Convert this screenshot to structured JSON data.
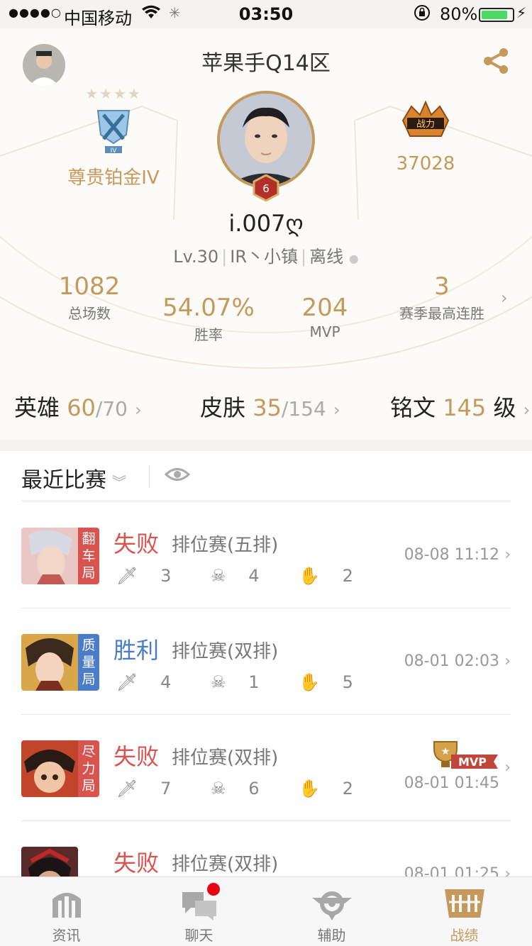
{
  "status": {
    "carrier": "中国移动",
    "time": "03:50",
    "battery": "80%"
  },
  "header": {
    "server": "苹果手Q14区"
  },
  "rank": {
    "label": "尊贵铂金IV"
  },
  "war": {
    "value": "37028"
  },
  "profile": {
    "level_badge": "6",
    "name": "i.007ღ",
    "level": "Lv.30",
    "team": "IR丶小镇",
    "status": "离线"
  },
  "stats": [
    {
      "value": "1082",
      "label": "总场数"
    },
    {
      "value": "54.07%",
      "label": "胜率"
    },
    {
      "value": "204",
      "label": "MVP"
    },
    {
      "value": "3",
      "label": "赛季最高连胜"
    }
  ],
  "collection": {
    "heroes": {
      "label": "英雄",
      "owned": "60",
      "total": "/70"
    },
    "skins": {
      "label": "皮肤",
      "owned": "35",
      "total": "/154"
    },
    "runes": {
      "label": "铭文",
      "value": "145",
      "unit": "级"
    }
  },
  "recent": {
    "title": "最近比赛"
  },
  "matches": [
    {
      "tag": "翻车局",
      "result": "失败",
      "type": "排位赛(五排)",
      "kills": "3",
      "deaths": "4",
      "assists": "2",
      "time": "08-08 11:12",
      "mvp": false
    },
    {
      "tag": "质量局",
      "result": "胜利",
      "type": "排位赛(双排)",
      "kills": "4",
      "deaths": "1",
      "assists": "5",
      "time": "08-01 02:03",
      "mvp": false
    },
    {
      "tag": "尽力局",
      "result": "失败",
      "type": "排位赛(双排)",
      "kills": "7",
      "deaths": "6",
      "assists": "2",
      "time": "08-01 01:45",
      "mvp": true,
      "mvp_label": "MVP"
    },
    {
      "tag": "",
      "result": "失败",
      "type": "排位赛(双排)",
      "kills": "",
      "deaths": "",
      "assists": "",
      "time": "08-01 01:25",
      "mvp": false
    }
  ],
  "tabs": [
    {
      "label": "资讯",
      "active": false
    },
    {
      "label": "聊天",
      "active": false
    },
    {
      "label": "辅助",
      "active": false
    },
    {
      "label": "战绩",
      "active": true
    }
  ],
  "colors": {
    "gold": "#c5995c",
    "win": "#4a7cc9",
    "loss": "#d9534f"
  }
}
